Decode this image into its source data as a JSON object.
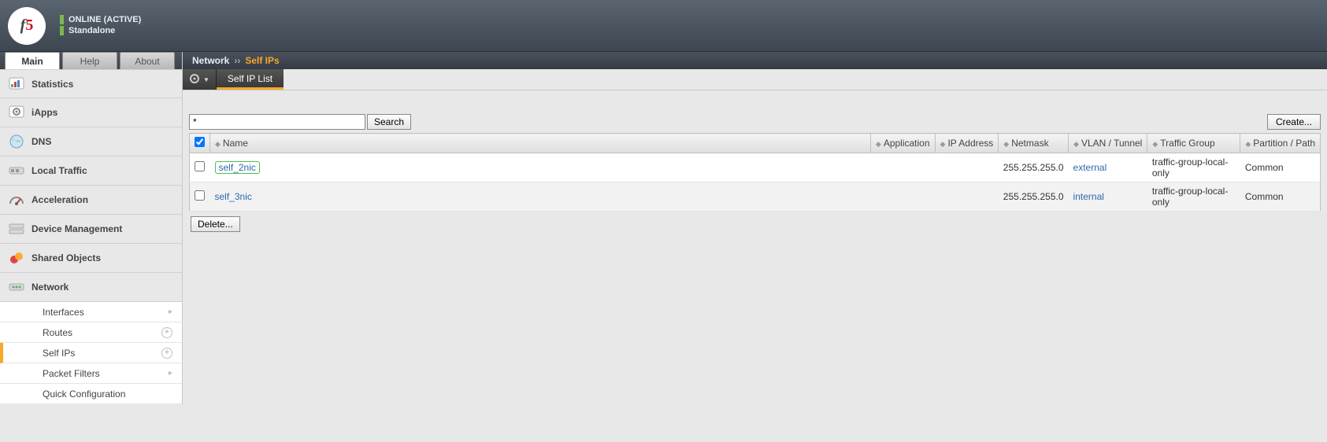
{
  "header": {
    "status1": "ONLINE (ACTIVE)",
    "status2": "Standalone",
    "logo_f": "f",
    "logo_5": "5"
  },
  "tabs": {
    "main": "Main",
    "help": "Help",
    "about": "About"
  },
  "sidebar": {
    "items": [
      {
        "label": "Statistics"
      },
      {
        "label": "iApps"
      },
      {
        "label": "DNS"
      },
      {
        "label": "Local Traffic"
      },
      {
        "label": "Acceleration"
      },
      {
        "label": "Device Management"
      },
      {
        "label": "Shared Objects"
      },
      {
        "label": "Network"
      }
    ],
    "network_sub": [
      {
        "label": "Interfaces",
        "icon": "arrow"
      },
      {
        "label": "Routes",
        "icon": "plus"
      },
      {
        "label": "Self IPs",
        "icon": "plus",
        "active": true
      },
      {
        "label": "Packet Filters",
        "icon": "arrow"
      },
      {
        "label": "Quick Configuration",
        "icon": ""
      }
    ]
  },
  "breadcrumb": {
    "root": "Network",
    "sep": "››",
    "current": "Self IPs"
  },
  "subtab": {
    "list": "Self IP List"
  },
  "search": {
    "value": "*",
    "button": "Search"
  },
  "buttons": {
    "create": "Create...",
    "delete": "Delete..."
  },
  "table": {
    "headers": {
      "name": "Name",
      "application": "Application",
      "ip": "IP Address",
      "netmask": "Netmask",
      "vlan": "VLAN / Tunnel",
      "traffic": "Traffic Group",
      "partition": "Partition / Path"
    },
    "rows": [
      {
        "name": "self_2nic",
        "application": "",
        "ip": "",
        "netmask": "255.255.255.0",
        "vlan": "external",
        "traffic": "traffic-group-local-only",
        "partition": "Common",
        "highlight": true
      },
      {
        "name": "self_3nic",
        "application": "",
        "ip": "",
        "netmask": "255.255.255.0",
        "vlan": "internal",
        "traffic": "traffic-group-local-only",
        "partition": "Common",
        "highlight": false
      }
    ]
  }
}
